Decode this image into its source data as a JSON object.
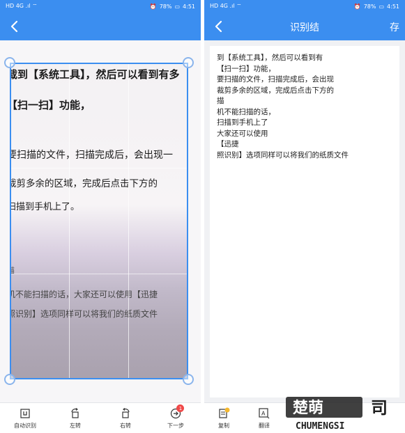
{
  "left": {
    "status": {
      "left": "HD 4G .ıl ⌔",
      "battery": "78%",
      "time": "4:51"
    },
    "photo_lines": [
      "载到【系统工具】，然后可以看到有多",
      "【扫一扫】功能，",
      "要扫描的文件，扫描完成后，会出现一",
      "裁剪多余的区域，完成后点击下方的",
      "扫描到手机上了。",
      "描",
      "机不能扫描的话，大家还可以使用【迅捷",
      "照识别】选项同样可以将我们的纸质文件"
    ],
    "toolbar": [
      {
        "label": "自动识别",
        "icon": "auto-detect-icon"
      },
      {
        "label": "左转",
        "icon": "rotate-left-icon"
      },
      {
        "label": "右转",
        "icon": "rotate-right-icon"
      },
      {
        "label": "下一步",
        "icon": "next-icon",
        "badge": "1"
      }
    ]
  },
  "right": {
    "status": {
      "left": "HD 4G .ıl ⌔",
      "battery": "78%",
      "time": "4:51"
    },
    "title": "识别结",
    "action": "存",
    "text_lines": [
      "到【系统工具】，然后可以看到有",
      "【扫一扫】功能，",
      "要扫描的文件，扫描完成后，会出现",
      "裁剪多余的区域，完成后点击下方的",
      "描",
      "机不能扫描的话，",
      "扫描到手机上了",
      "大家还可以使用",
      "【迅捷",
      "照识别】选项同样可以将我们的纸质文件"
    ],
    "toolbar": [
      {
        "label": "复制",
        "icon": "copy-icon"
      },
      {
        "label": "翻译",
        "icon": "translate-icon"
      }
    ]
  },
  "watermark": {
    "text": "CHUMENGSI"
  },
  "colors": {
    "accent": "#3b8ef0",
    "badge": "#f04848"
  }
}
